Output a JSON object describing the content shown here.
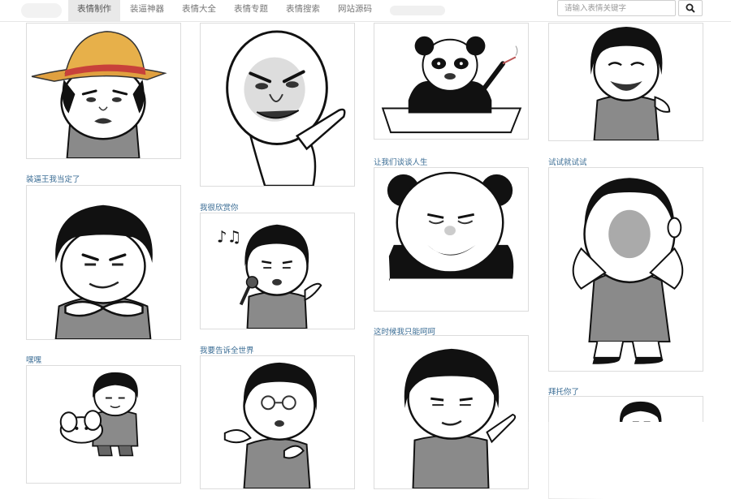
{
  "nav": {
    "tabs": [
      "表情制作",
      "装逼神器",
      "表情大全",
      "表情专题",
      "表情搜索",
      "网站源码"
    ],
    "active_tab": "表情制作"
  },
  "search": {
    "placeholder": "请输入表情关键字"
  },
  "icons": {
    "search": "search-icon"
  },
  "cards": [
    {
      "caption": "",
      "style": "hat-boy"
    },
    {
      "caption": "",
      "style": "bald-pointing"
    },
    {
      "caption": "",
      "style": "panda-desk"
    },
    {
      "caption": "",
      "style": "bowl-laughing"
    },
    {
      "caption": "装逼王我当定了",
      "style": "bowl-sly"
    },
    {
      "caption": "我很欣赏你",
      "style": "bowl-singing"
    },
    {
      "caption": "让我们谈谈人生",
      "style": "panda-face"
    },
    {
      "caption": "试试就试试",
      "style": "bowl-crying"
    },
    {
      "caption": "嘿嘿",
      "style": "bowl-puppy"
    },
    {
      "caption": "我要告诉全世界",
      "style": "bowl-glasses"
    },
    {
      "caption": "这时候我只能呵呵",
      "style": "bowl-shrug"
    },
    {
      "caption": "拜托你了",
      "style": "bowl-peek"
    }
  ]
}
